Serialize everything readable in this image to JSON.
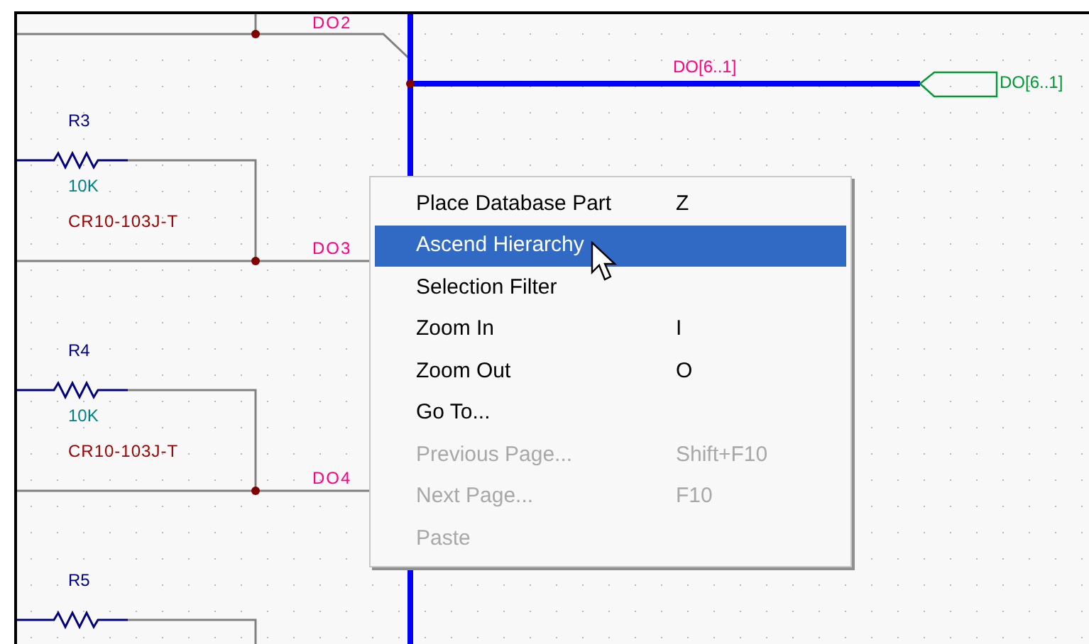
{
  "schematic": {
    "nets": [
      "DO2",
      "DO3",
      "DO4"
    ],
    "components": [
      {
        "ref": "R3",
        "value": "10K",
        "part": "CR10-103J-T"
      },
      {
        "ref": "R4",
        "value": "10K",
        "part": "CR10-103J-T"
      },
      {
        "ref": "R5"
      }
    ],
    "bus_label": "DO[6..1]",
    "port_label": "DO[6..1]"
  },
  "context_menu": [
    {
      "label": "Place Database Part",
      "shortcut": "Z",
      "selected": false,
      "disabled": false
    },
    {
      "label": "Ascend Hierarchy",
      "selected": true,
      "disabled": false
    },
    {
      "label": "Selection Filter",
      "selected": false,
      "disabled": false
    },
    {
      "label": "Zoom In",
      "shortcut": "I",
      "selected": false,
      "disabled": false
    },
    {
      "label": "Zoom Out",
      "shortcut": "O",
      "selected": false,
      "disabled": false
    },
    {
      "label": "Go To...",
      "selected": false,
      "disabled": false
    },
    {
      "label": "Previous Page...",
      "shortcut": "Shift+F10",
      "selected": false,
      "disabled": true
    },
    {
      "label": "Next Page...",
      "shortcut": "F10",
      "selected": false,
      "disabled": true
    },
    {
      "label": "Paste",
      "selected": false,
      "disabled": true
    }
  ]
}
